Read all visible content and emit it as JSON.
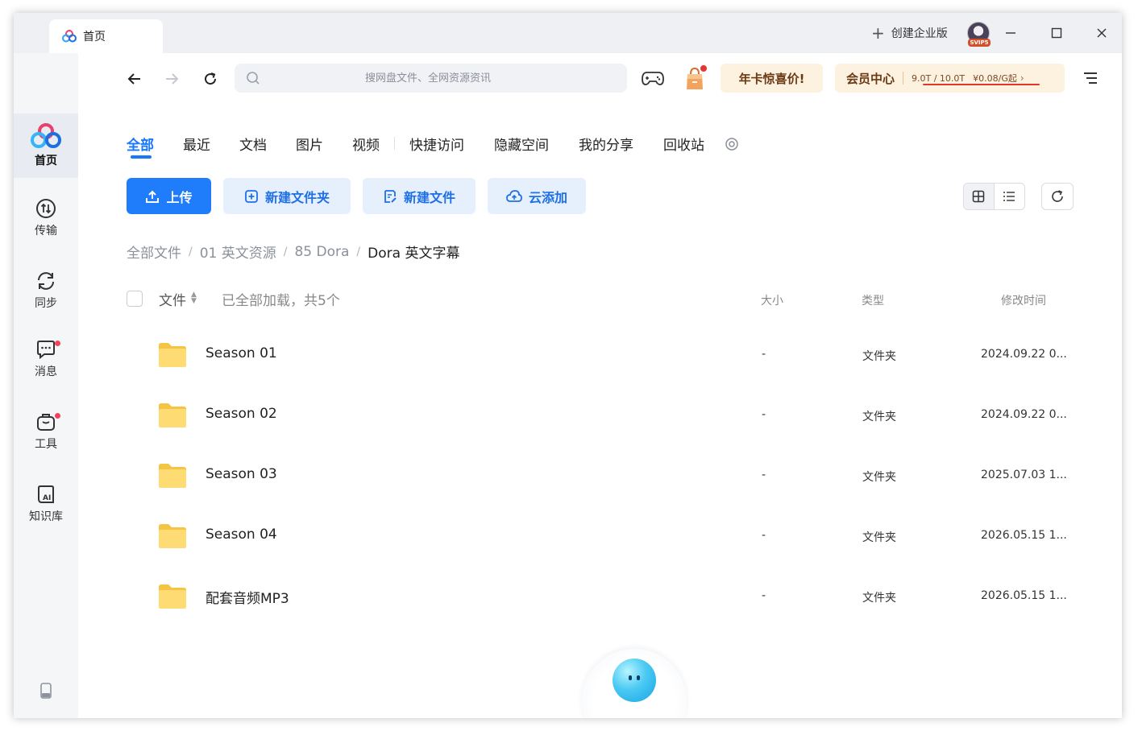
{
  "titlebar": {
    "tab_label": "首页",
    "enterprise_label": "创建企业版",
    "avatar_badge": "SVIP5"
  },
  "sidebar": {
    "items": [
      {
        "label": "首页",
        "icon": "home-logo-icon",
        "active": true
      },
      {
        "label": "传输",
        "icon": "transfer-icon"
      },
      {
        "label": "同步",
        "icon": "sync-icon"
      },
      {
        "label": "消息",
        "icon": "message-icon",
        "badge": true
      },
      {
        "label": "工具",
        "icon": "toolbox-icon",
        "badge": true
      },
      {
        "label": "知识库",
        "icon": "knowledge-base-icon"
      }
    ]
  },
  "search": {
    "placeholder": "搜网盘文件、全网资源资讯"
  },
  "promo": {
    "label": "年卡惊喜价!"
  },
  "vip_center": {
    "label": "会员中心",
    "quota": "9.0T / 10.0T",
    "price": "¥0.08/G起"
  },
  "categories": [
    "全部",
    "最近",
    "文档",
    "图片",
    "视频",
    "快捷访问",
    "隐藏空间",
    "我的分享",
    "回收站"
  ],
  "actions": {
    "upload": "上传",
    "new_folder": "新建文件夹",
    "new_file": "新建文件",
    "cloud_add": "云添加"
  },
  "breadcrumb": [
    "全部文件",
    "01 英文资源",
    "85 Dora",
    "Dora 英文字幕"
  ],
  "list_header": {
    "file": "文件",
    "loaded": "已全部加载，共5个",
    "size": "大小",
    "type": "类型",
    "modified": "修改时间"
  },
  "files": [
    {
      "name": "Season 01",
      "size": "-",
      "type": "文件夹",
      "modified": "2024.09.22 0..."
    },
    {
      "name": "Season 02",
      "size": "-",
      "type": "文件夹",
      "modified": "2024.09.22 0..."
    },
    {
      "name": "Season 03",
      "size": "-",
      "type": "文件夹",
      "modified": "2025.07.03 1..."
    },
    {
      "name": "Season 04",
      "size": "-",
      "type": "文件夹",
      "modified": "2026.05.15 1..."
    },
    {
      "name": "配套音频MP3",
      "size": "-",
      "type": "文件夹",
      "modified": "2026.05.15 1..."
    }
  ],
  "colors": {
    "accent": "#1677ff",
    "promo_bg": "#fdf1e0",
    "badge_red": "#f2435c",
    "folder_yellow": "#ffd766"
  }
}
